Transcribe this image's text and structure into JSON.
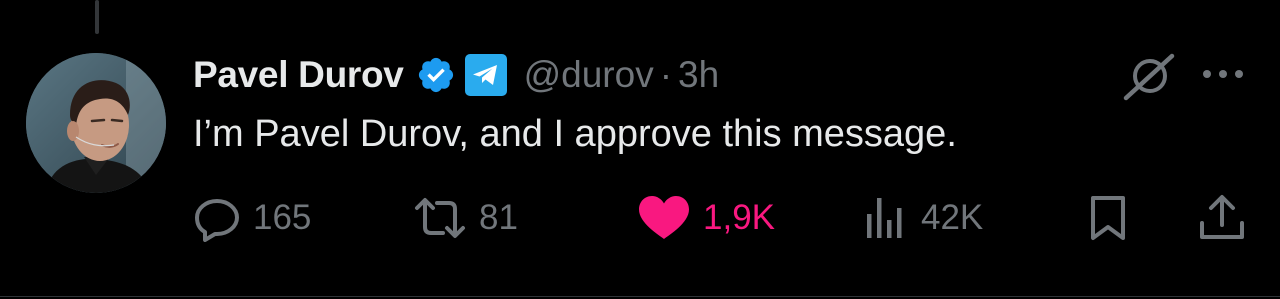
{
  "tweet": {
    "display_name": "Pavel Durov",
    "handle": "@durov",
    "separator": "·",
    "time": "3h",
    "text": "I’m Pavel Durov, and I approve this message."
  },
  "actions": {
    "replies": "165",
    "reposts": "81",
    "likes": "1,9K",
    "views": "42K"
  },
  "icons": {
    "verified": "verified-badge-icon",
    "affiliate": "telegram-icon",
    "grok": "grok-icon",
    "more": "more-dots-icon",
    "reply": "reply-icon",
    "repost": "repost-icon",
    "like": "heart-icon",
    "views": "views-icon",
    "bookmark": "bookmark-icon",
    "share": "share-icon"
  },
  "colors": {
    "background": "#000000",
    "primary_text": "#e7e9ea",
    "secondary_text": "#71767b",
    "verified_blue": "#1d9bf0",
    "telegram_blue": "#2aabee",
    "like_pink": "#f91880"
  }
}
